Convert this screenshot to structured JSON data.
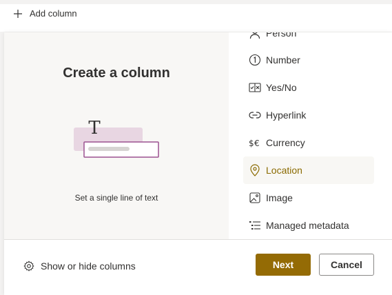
{
  "toolbar": {
    "add_column_label": "Add column"
  },
  "preview": {
    "title": "Create a column",
    "description": "Set a single line of text"
  },
  "column_types": [
    {
      "label": "Person",
      "icon": "person-icon"
    },
    {
      "label": "Number",
      "icon": "number-icon"
    },
    {
      "label": "Yes/No",
      "icon": "yes-no-icon"
    },
    {
      "label": "Hyperlink",
      "icon": "link-icon"
    },
    {
      "label": "Currency",
      "icon": "currency-icon"
    },
    {
      "label": "Location",
      "icon": "location-icon",
      "selected": true
    },
    {
      "label": "Image",
      "icon": "image-icon"
    },
    {
      "label": "Managed metadata",
      "icon": "managed-metadata-icon"
    }
  ],
  "footer": {
    "show_hide_label": "Show or hide columns",
    "next_label": "Next",
    "cancel_label": "Cancel"
  },
  "colors": {
    "accent": "#946b05",
    "selected_text": "#8a6a00",
    "selected_bg": "#f8f7f4"
  }
}
